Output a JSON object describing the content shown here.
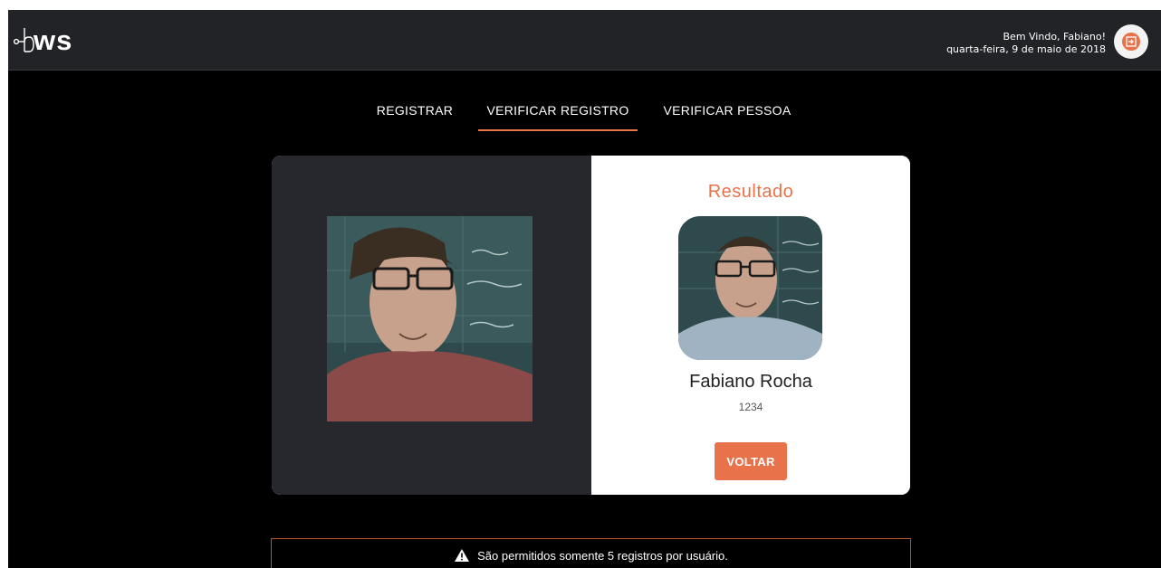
{
  "header": {
    "logo_text": "ws",
    "welcome": "Bem Vindo, Fabiano!",
    "date": "quarta-feira, 9 de maio de 2018",
    "logout_icon": "logout-icon"
  },
  "tabs": [
    {
      "label": "REGISTRAR",
      "active": false
    },
    {
      "label": "VERIFICAR REGISTRO",
      "active": true
    },
    {
      "label": "VERIFICAR PESSOA",
      "active": false
    }
  ],
  "result": {
    "title": "Resultado",
    "name": "Fabiano Rocha",
    "id": "1234",
    "back_label": "VOLTAR"
  },
  "alert": {
    "icon": "warning-icon",
    "message": "São permitidos somente 5 registros por usuário."
  },
  "colors": {
    "accent": "#e8734a",
    "topbar": "#222327",
    "panel_dark": "#27282d",
    "background": "#000000"
  }
}
